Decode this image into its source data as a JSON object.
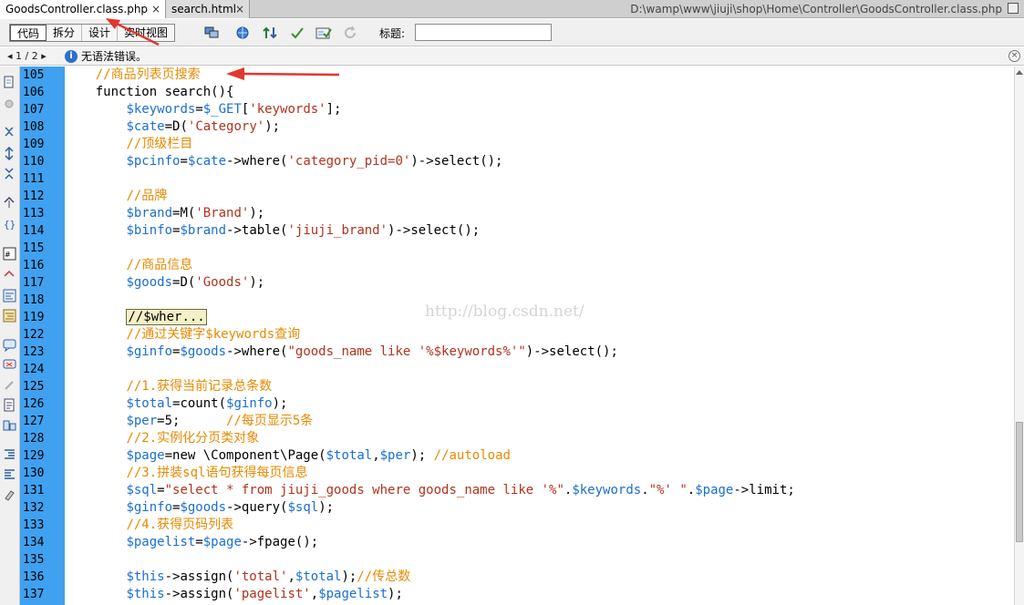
{
  "tabs": [
    {
      "label": "GoodsController.class.php",
      "active": true,
      "close": "×"
    },
    {
      "label": "search.html",
      "active": false,
      "close": "×"
    }
  ],
  "file_path": "D:\\wamp\\www\\jiuji\\shop\\Home\\Controller\\GoodsController.class.php",
  "toolbar": {
    "views": [
      "代码",
      "拆分",
      "设计",
      "实时视图"
    ],
    "active_view": "代码",
    "title_label": "标题:",
    "title_value": ""
  },
  "status": {
    "pager": "◂ 1 / 2 ▸",
    "info_icon": "i",
    "message": "无语法错误。",
    "close": "×"
  },
  "watermark": "http://blog.csdn.net/",
  "code_lines": [
    {
      "n": "105",
      "html": "    <span class=\"c\">//商品列表页搜索</span>"
    },
    {
      "n": "106",
      "html": "    function search(){"
    },
    {
      "n": "107",
      "html": "        <span class=\"v\">$keywords</span>=<span class=\"v\">$_GET</span>[<span class=\"s\">'keywords'</span>];"
    },
    {
      "n": "108",
      "html": "        <span class=\"v\">$cate</span>=D(<span class=\"s\">'Category'</span>);"
    },
    {
      "n": "109",
      "html": "        <span class=\"c\">//顶级栏目</span>"
    },
    {
      "n": "110",
      "html": "        <span class=\"v\">$pcinfo</span>=<span class=\"v\">$cate</span>->where(<span class=\"s\">'category_pid=0'</span>)->select();"
    },
    {
      "n": "111",
      "html": ""
    },
    {
      "n": "112",
      "html": "        <span class=\"c\">//品牌</span>"
    },
    {
      "n": "113",
      "html": "        <span class=\"v\">$brand</span>=M(<span class=\"s\">'Brand'</span>);"
    },
    {
      "n": "114",
      "html": "        <span class=\"v\">$binfo</span>=<span class=\"v\">$brand</span>->table(<span class=\"s\">'jiuji_brand'</span>)->select();"
    },
    {
      "n": "115",
      "html": ""
    },
    {
      "n": "116",
      "html": "        <span class=\"c\">//商品信息</span>"
    },
    {
      "n": "117",
      "html": "        <span class=\"v\">$goods</span>=D(<span class=\"s\">'Goods'</span>);"
    },
    {
      "n": "118",
      "html": ""
    },
    {
      "n": "119",
      "html": "        <span class=\"fold\">//$wher...</span>"
    },
    {
      "n": "122",
      "html": "        <span class=\"c\">//通过关键字$keywords查询</span>"
    },
    {
      "n": "123",
      "html": "        <span class=\"v\">$ginfo</span>=<span class=\"v\">$goods</span>->where(<span class=\"s\">\"goods_name like '%$keywords%'\"</span>)->select();"
    },
    {
      "n": "124",
      "html": ""
    },
    {
      "n": "125",
      "html": "        <span class=\"c\">//1.获得当前记录总条数</span>"
    },
    {
      "n": "126",
      "html": "        <span class=\"v\">$total</span>=count(<span class=\"v\">$ginfo</span>);"
    },
    {
      "n": "127",
      "html": "        <span class=\"v\">$per</span>=5;      <span class=\"c\">//每页显示5条</span>"
    },
    {
      "n": "128",
      "html": "        <span class=\"c\">//2.实例化分页类对象</span>"
    },
    {
      "n": "129",
      "html": "        <span class=\"v\">$page</span>=new \\Component\\Page(<span class=\"v\">$total</span>,<span class=\"v\">$per</span>); <span class=\"c\">//autoload</span>"
    },
    {
      "n": "130",
      "html": "        <span class=\"c\">//3.拼装sql语句获得每页信息</span>"
    },
    {
      "n": "131",
      "html": "        <span class=\"v\">$sql</span>=<span class=\"s\">\"select * from jiuji_goods where goods_name like '%\"</span>.<span class=\"v\">$keywords</span>.<span class=\"s\">\"%' \"</span>.<span class=\"v\">$page</span>->limit;"
    },
    {
      "n": "132",
      "html": "        <span class=\"v\">$ginfo</span>=<span class=\"v\">$goods</span>->query(<span class=\"v\">$sql</span>);"
    },
    {
      "n": "133",
      "html": "        <span class=\"c\">//4.获得页码列表</span>"
    },
    {
      "n": "134",
      "html": "        <span class=\"v\">$pagelist</span>=<span class=\"v\">$page</span>->fpage();"
    },
    {
      "n": "135",
      "html": ""
    },
    {
      "n": "136",
      "html": "        <span class=\"v\">$this</span>->assign(<span class=\"s\">'total'</span>,<span class=\"v\">$total</span>);<span class=\"c\">//传总数</span>"
    },
    {
      "n": "137",
      "html": "        <span class=\"v\">$this</span>->assign(<span class=\"s\">'pagelist'</span>,<span class=\"v\">$pagelist</span>);"
    }
  ],
  "colors": {
    "gutter": "#3fa1f0",
    "variable": "#1a6fd1",
    "string": "#b0331f",
    "comment": "#e68a00",
    "arrow": "#e2372b"
  }
}
